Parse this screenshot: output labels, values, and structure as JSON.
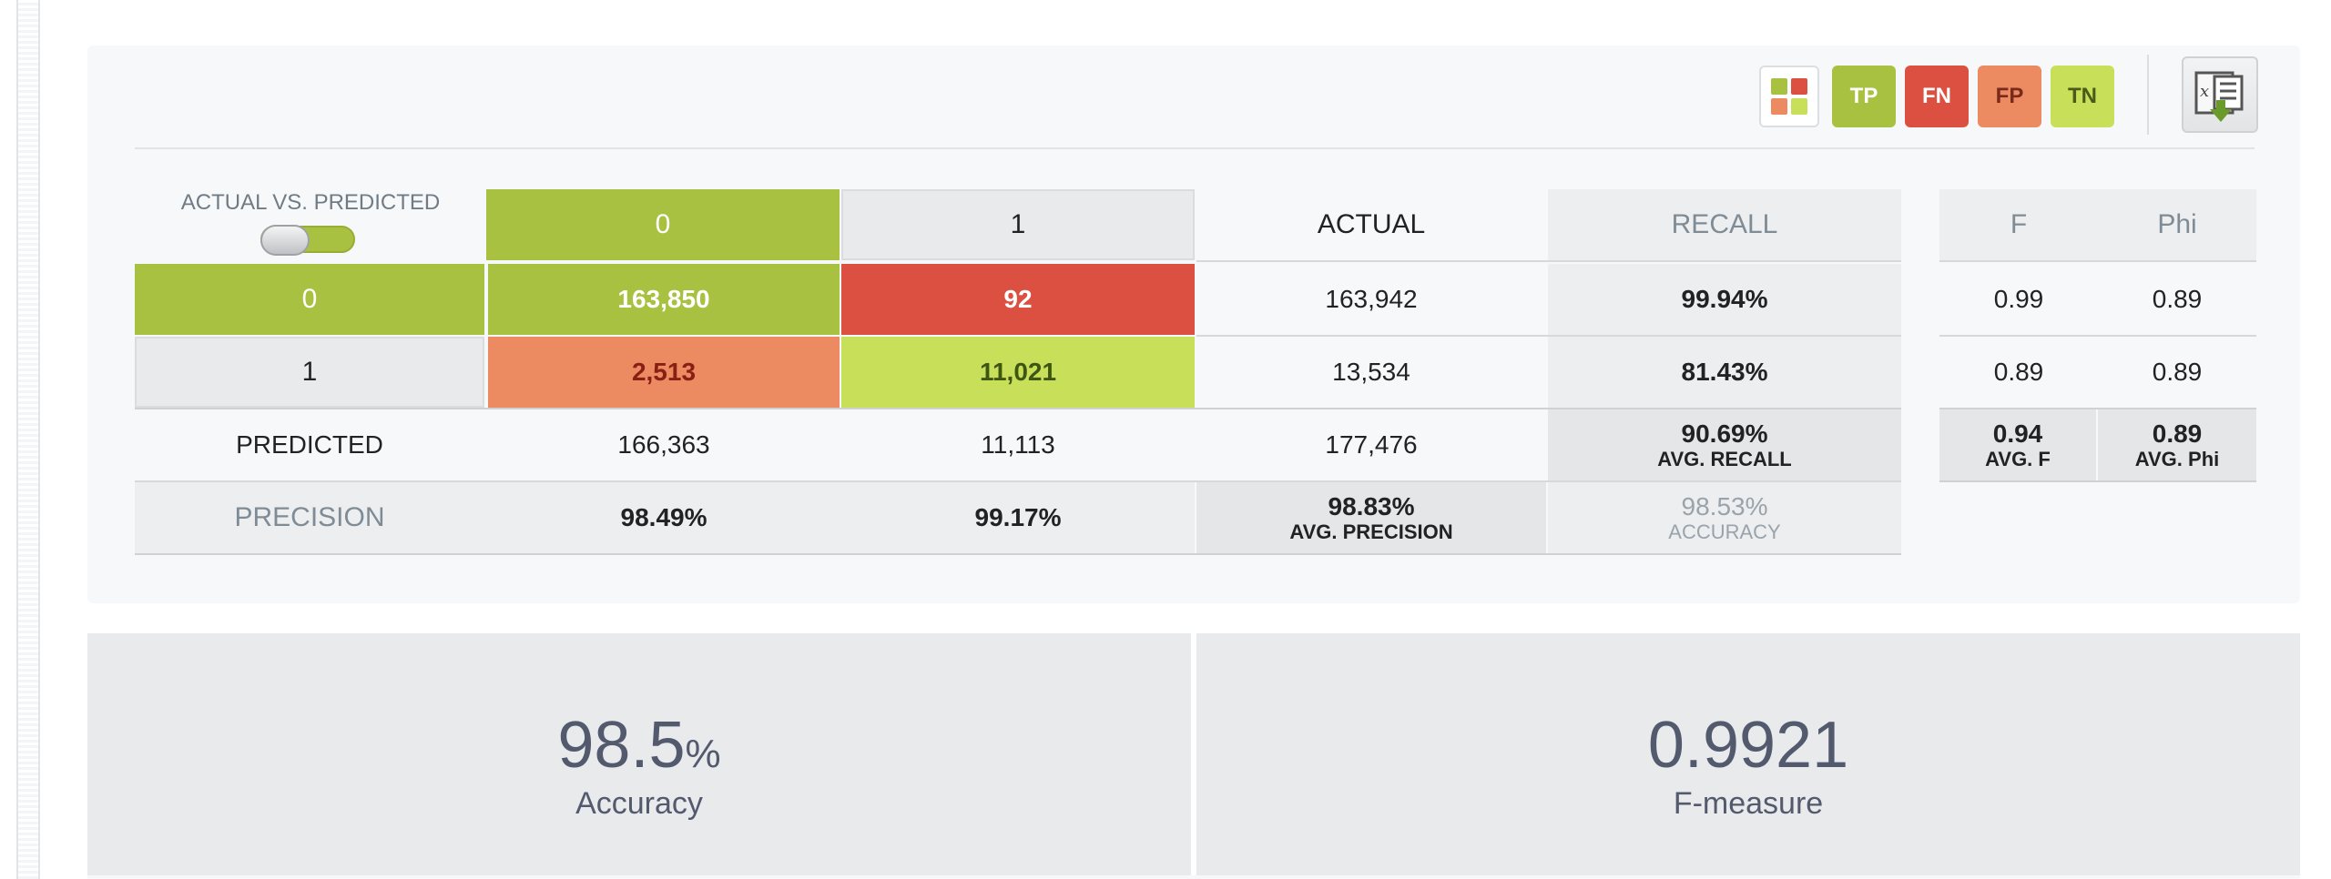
{
  "legend": {
    "tp": "TP",
    "fn": "FN",
    "fp": "FP",
    "tn": "TN",
    "colors": {
      "tp": "#a9c140",
      "fn": "#db5040",
      "fp": "#ec8a62",
      "tn": "#c8df5a"
    }
  },
  "matrix": {
    "corner_label": "ACTUAL VS. PREDICTED",
    "col_headers": [
      "0",
      "1"
    ],
    "row_headers": [
      "0",
      "1"
    ],
    "actual_header": "ACTUAL",
    "recall_header": "RECALL",
    "rows": [
      {
        "tp": "163,850",
        "fn": "92",
        "actual": "163,942",
        "recall": "99.94%"
      },
      {
        "fp": "2,513",
        "tn": "11,021",
        "actual": "13,534",
        "recall": "81.43%"
      }
    ],
    "predicted_label": "PREDICTED",
    "predicted": [
      "166,363",
      "11,113"
    ],
    "total": "177,476",
    "avg_recall": "90.69%",
    "avg_recall_label": "AVG. RECALL",
    "precision_label": "PRECISION",
    "precision": [
      "98.49%",
      "99.17%"
    ],
    "avg_precision": "98.83%",
    "avg_precision_label": "AVG. PRECISION",
    "accuracy": "98.53%",
    "accuracy_label": "ACCURACY"
  },
  "scores": {
    "f_header": "F",
    "phi_header": "Phi",
    "rows": [
      {
        "f": "0.99",
        "phi": "0.89"
      },
      {
        "f": "0.89",
        "phi": "0.89"
      }
    ],
    "avg_f": "0.94",
    "avg_f_label": "AVG. F",
    "avg_phi": "0.89",
    "avg_phi_label": "AVG. Phi"
  },
  "stats": [
    {
      "value": "98.5",
      "unit": "%",
      "label": "Accuracy"
    },
    {
      "value": "0.9921",
      "unit": "",
      "label": "F-measure"
    }
  ],
  "icons": {
    "grid": "color-grid-icon",
    "export": "excel-export-icon"
  }
}
